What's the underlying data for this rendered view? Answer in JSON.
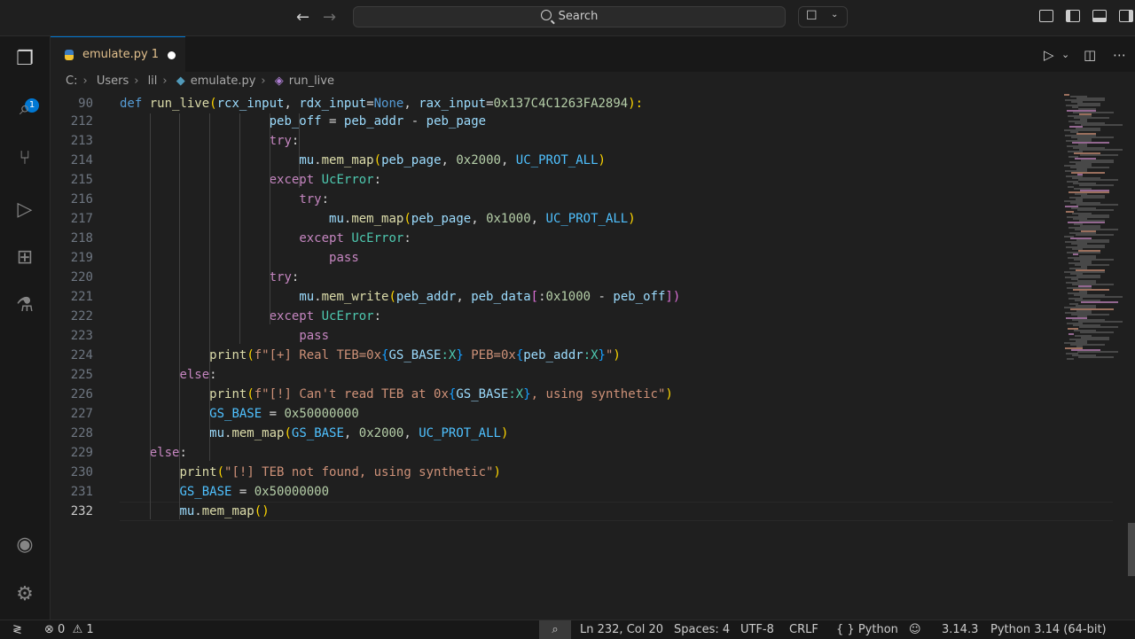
{
  "titlebar": {
    "back_icon": "arrow-left",
    "forward_icon": "arrow-right",
    "search_placeholder": "Search"
  },
  "activity_bar": {
    "explorer_badge": "1",
    "items": [
      "explorer-icon",
      "search-icon",
      "source-control-icon",
      "run-debug-icon",
      "extensions-icon",
      "testing-icon"
    ],
    "bottom": [
      "account-icon",
      "settings-gear-icon"
    ]
  },
  "tab": {
    "filename": "emulate.py",
    "problem_count": "1"
  },
  "breadcrumb": {
    "drive": "C:",
    "users": "Users",
    "user": "lil",
    "file": "emulate.py",
    "symbol": "run_live"
  },
  "editor": {
    "sticky_line_number": "90",
    "lines": [
      {
        "n": "212"
      },
      {
        "n": "213"
      },
      {
        "n": "214"
      },
      {
        "n": "215"
      },
      {
        "n": "216"
      },
      {
        "n": "217"
      },
      {
        "n": "218"
      },
      {
        "n": "219"
      },
      {
        "n": "220"
      },
      {
        "n": "221"
      },
      {
        "n": "222"
      },
      {
        "n": "223"
      },
      {
        "n": "224"
      },
      {
        "n": "225"
      },
      {
        "n": "226"
      },
      {
        "n": "227"
      },
      {
        "n": "228"
      },
      {
        "n": "229"
      },
      {
        "n": "230"
      },
      {
        "n": "231"
      },
      {
        "n": "232"
      }
    ]
  },
  "code_text": {
    "sticky": [
      "def",
      " ",
      "run_live",
      "(",
      "rcx_input",
      ", ",
      "rdx_input",
      "=",
      "None",
      ", ",
      "rax_input",
      "=",
      "0x137C4C1263FA2894",
      "):"
    ],
    "l212": [
      "peb_off",
      " = ",
      "peb_addr",
      " - ",
      "peb_page"
    ],
    "l213": [
      "try",
      ":"
    ],
    "l214": [
      "mu",
      ".",
      "mem_map",
      "(",
      "peb_page",
      ", ",
      "0x2000",
      ", ",
      "UC_PROT_ALL",
      ")"
    ],
    "l215": [
      "except",
      " ",
      "UcError",
      ":"
    ],
    "l216": [
      "try",
      ":"
    ],
    "l217": [
      "mu",
      ".",
      "mem_map",
      "(",
      "peb_page",
      ", ",
      "0x1000",
      ", ",
      "UC_PROT_ALL",
      ")"
    ],
    "l218": [
      "except",
      " ",
      "UcError",
      ":"
    ],
    "l219": [
      "pass"
    ],
    "l220": [
      "try",
      ":"
    ],
    "l221": [
      "mu",
      ".",
      "mem_write",
      "(",
      "peb_addr",
      ", ",
      "peb_data",
      "[",
      ":",
      "0x1000",
      " - ",
      "peb_off",
      "])"
    ],
    "l222": [
      "except",
      " ",
      "UcError",
      ":"
    ],
    "l223": [
      "pass"
    ],
    "l224": [
      "print",
      "(",
      "f\"[+] Real TEB=0x",
      "{",
      "GS_BASE",
      ":X",
      "}",
      " PEB=0x",
      "{",
      "peb_addr",
      ":X",
      "}",
      "\"",
      ")"
    ],
    "l225": [
      "else",
      ":"
    ],
    "l226": [
      "print",
      "(",
      "f\"[!] Can't read TEB at 0x",
      "{",
      "GS_BASE",
      ":X",
      "}",
      ", using synthetic\"",
      ")"
    ],
    "l227": [
      "GS_BASE",
      " = ",
      "0x50000000"
    ],
    "l228": [
      "mu",
      ".",
      "mem_map",
      "(",
      "GS_BASE",
      ", ",
      "0x2000",
      ", ",
      "UC_PROT_ALL",
      ")"
    ],
    "l229": [
      "else",
      ":"
    ],
    "l230": [
      "print",
      "(",
      "\"[!] TEB not found, using synthetic\"",
      ")"
    ],
    "l231": [
      "GS_BASE",
      " = ",
      "0x50000000"
    ],
    "l232": [
      "mu",
      ".",
      "mem_map",
      "(",
      ")"
    ]
  },
  "statusbar": {
    "errors": "0",
    "warnings": "1",
    "position": "Ln 232, Col 20",
    "spaces": "Spaces: 4",
    "encoding": "UTF-8",
    "eol": "CRLF",
    "language": "Python",
    "braces_icon": "{ }",
    "interpreter_version": "3.14.3",
    "interpreter": "Python 3.14 (64-bit)"
  },
  "colors": {
    "accent": "#0078d4",
    "background": "#1f1f1f",
    "modified_tab_text": "#e2c08d"
  }
}
